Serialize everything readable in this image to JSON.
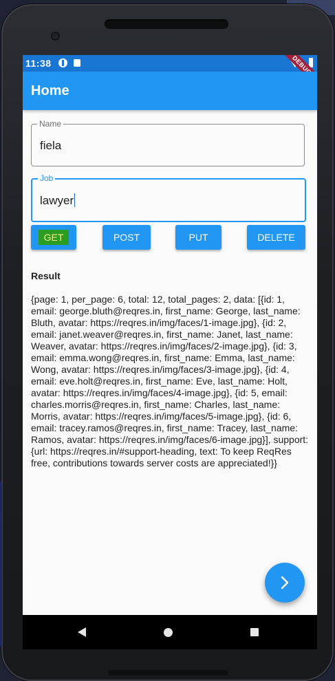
{
  "status_bar": {
    "time": "11:38",
    "debug_banner": "DEBUG"
  },
  "app_bar": {
    "title": "Home"
  },
  "form": {
    "name": {
      "label": "Name",
      "value": "fiela"
    },
    "job": {
      "label": "Job",
      "value": "lawyer"
    }
  },
  "buttons": {
    "get": "GET",
    "post": "POST",
    "put": "PUT",
    "delete": "DELETE"
  },
  "result": {
    "title": "Result",
    "text": "{page: 1, per_page: 6, total: 12, total_pages: 2, data: [{id: 1, email: george.bluth@reqres.in, first_name: George, last_name: Bluth, avatar: https://reqres.in/img/faces/1-image.jpg}, {id: 2, email: janet.weaver@reqres.in, first_name: Janet, last_name: Weaver, avatar: https://reqres.in/img/faces/2-image.jpg}, {id: 3, email: emma.wong@reqres.in, first_name: Emma, last_name: Wong, avatar: https://reqres.in/img/faces/3-image.jpg}, {id: 4, email: eve.holt@reqres.in, first_name: Eve, last_name: Holt, avatar: https://reqres.in/img/faces/4-image.jpg}, {id: 5, email: charles.morris@reqres.in, first_name: Charles, last_name: Morris, avatar: https://reqres.in/img/faces/5-image.jpg}, {id: 6, email: tracey.ramos@reqres.in, first_name: Tracey, last_name: Ramos, avatar: https://reqres.in/img/faces/6-image.jpg}], support: {url: https://reqres.in/#support-heading, text: To keep ReqRes free, contributions towards server costs are appreciated!}}"
  },
  "fab": {
    "icon": "chevron-right-icon"
  },
  "colors": {
    "primary": "#2196f3",
    "status_bar": "#1976d2",
    "get_highlight": "#2a9d22"
  }
}
